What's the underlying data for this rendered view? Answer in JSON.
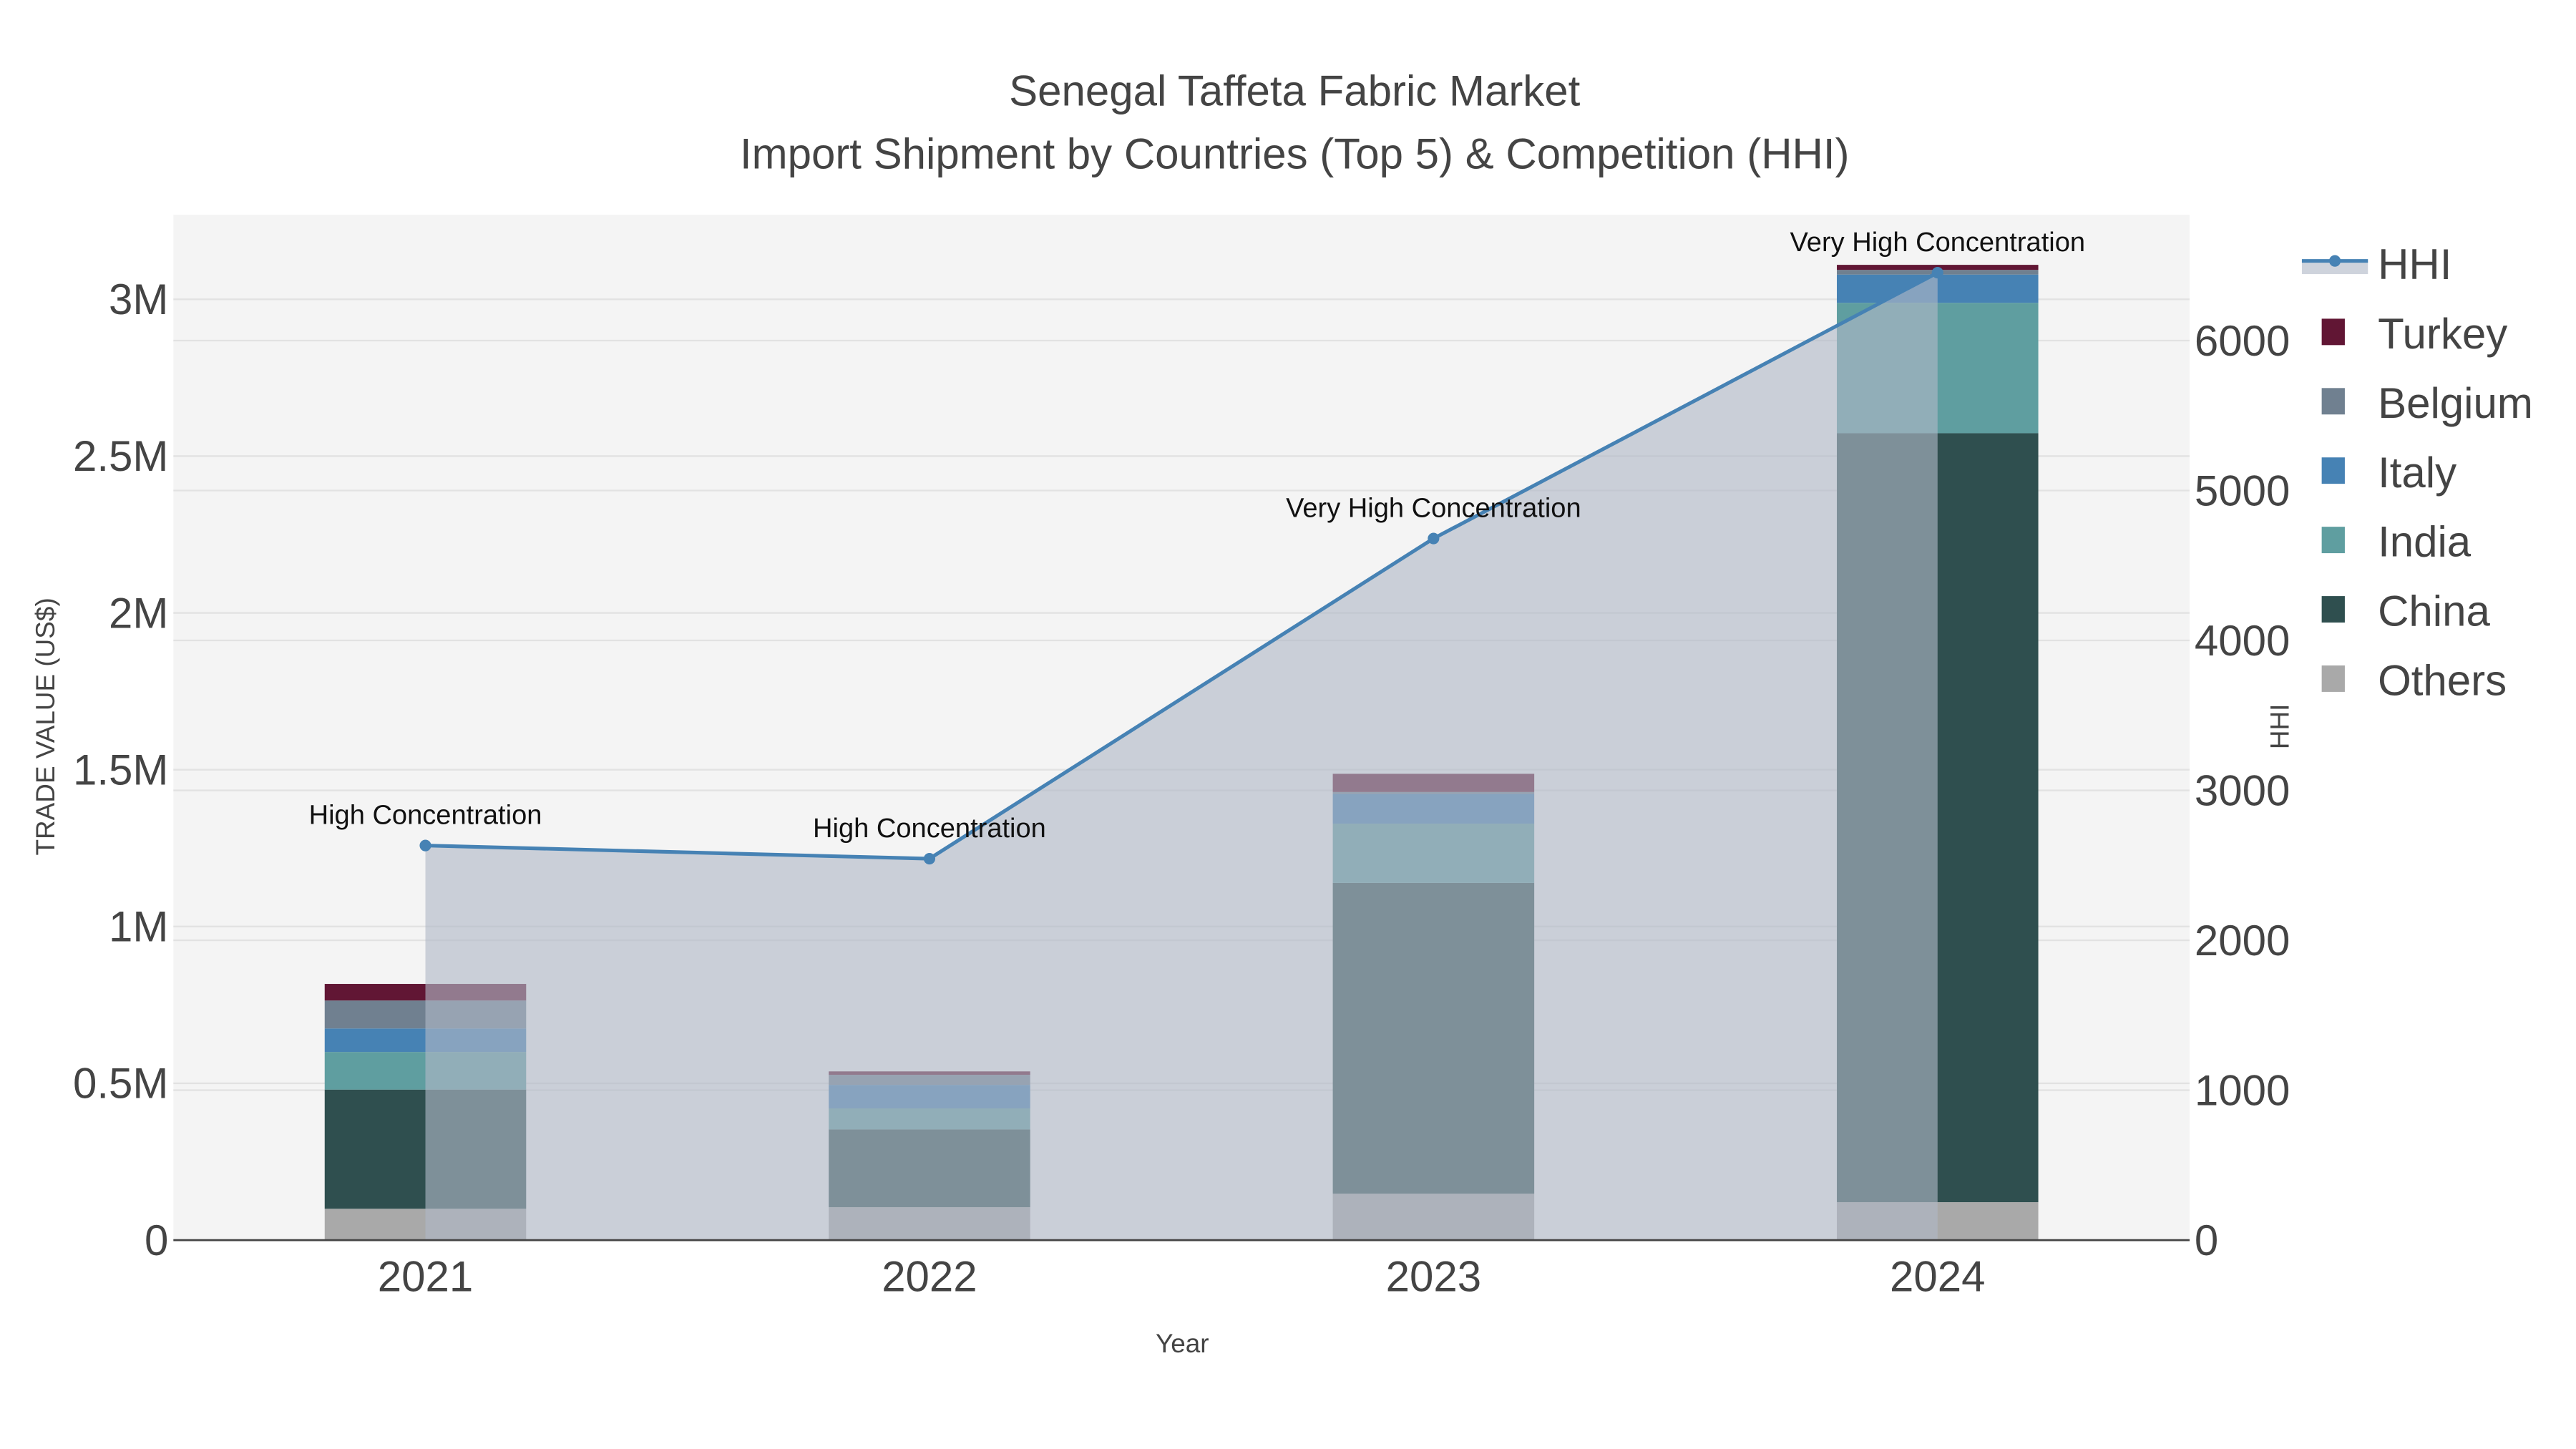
{
  "chart_data": {
    "type": "bar",
    "stacked": true,
    "title": "Senegal Taffeta Fabric Market",
    "subtitle": "Import Shipment by Countries (Top 5) & Competition (HHI)",
    "xlabel": "Year",
    "ylabel": "TRADE VALUE (US$)",
    "y2label": "HHI",
    "categories": [
      "2021",
      "2022",
      "2023",
      "2024"
    ],
    "ylim": [
      0,
      3270000
    ],
    "y2lim": [
      0,
      6840
    ],
    "yticks": [
      0,
      500000,
      1000000,
      1500000,
      2000000,
      2500000,
      3000000
    ],
    "ytick_labels": [
      "0",
      "0.5M",
      "1M",
      "1.5M",
      "2M",
      "2.5M",
      "3M"
    ],
    "y2ticks": [
      0,
      1000,
      2000,
      3000,
      4000,
      5000,
      6000
    ],
    "y2tick_labels": [
      "0",
      "1000",
      "2000",
      "3000",
      "4000",
      "5000",
      "6000"
    ],
    "series": [
      {
        "name": "Others",
        "color": "#a9a9a9",
        "values": [
          100000,
          105000,
          148000,
          121000
        ]
      },
      {
        "name": "China",
        "color": "#2f4f4f",
        "values": [
          380000,
          248000,
          991000,
          2452000
        ]
      },
      {
        "name": "India",
        "color": "#5f9ea0",
        "values": [
          120000,
          67000,
          189000,
          416000
        ]
      },
      {
        "name": "Italy",
        "color": "#4682b4",
        "values": [
          75000,
          75000,
          95000,
          90000
        ]
      },
      {
        "name": "Belgium",
        "color": "#708090",
        "values": [
          89000,
          32000,
          6000,
          15000
        ]
      },
      {
        "name": "Turkey",
        "color": "#611634",
        "values": [
          53000,
          11000,
          58000,
          16000
        ]
      }
    ],
    "line": {
      "name": "HHI",
      "color": "#4682b4",
      "values": [
        2632,
        2544,
        4680,
        6453
      ]
    },
    "annotations": [
      "High Concentration",
      "High Concentration",
      "Very High Concentration",
      "Very High Concentration"
    ],
    "legend": [
      "HHI",
      "Turkey",
      "Belgium",
      "Italy",
      "India",
      "China",
      "Others"
    ],
    "legend_position": "right",
    "grid": true
  }
}
